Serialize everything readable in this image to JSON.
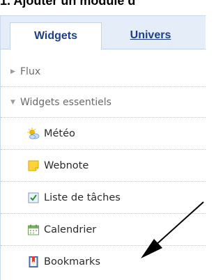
{
  "caption": "1. Ajouter un module d",
  "tabs": [
    {
      "label": "Widgets",
      "active": true
    },
    {
      "label": "Univers",
      "active": false
    }
  ],
  "sections": [
    {
      "label": "Flux",
      "expanded": false,
      "icon": "triangle-right-icon"
    },
    {
      "label": "Widgets essentiels",
      "expanded": true,
      "icon": "triangle-down-icon"
    }
  ],
  "widgets": [
    {
      "label": "Météo",
      "icon": "weather-icon"
    },
    {
      "label": "Webnote",
      "icon": "note-icon"
    },
    {
      "label": "Liste de tâches",
      "icon": "checkbox-icon"
    },
    {
      "label": "Calendrier",
      "icon": "calendar-icon"
    },
    {
      "label": "Bookmarks",
      "icon": "bookmark-icon"
    }
  ],
  "colors": {
    "tab_text": "#1d3f8a",
    "tabstrip_bg": "#e4edf8",
    "arrow": "#000000"
  }
}
